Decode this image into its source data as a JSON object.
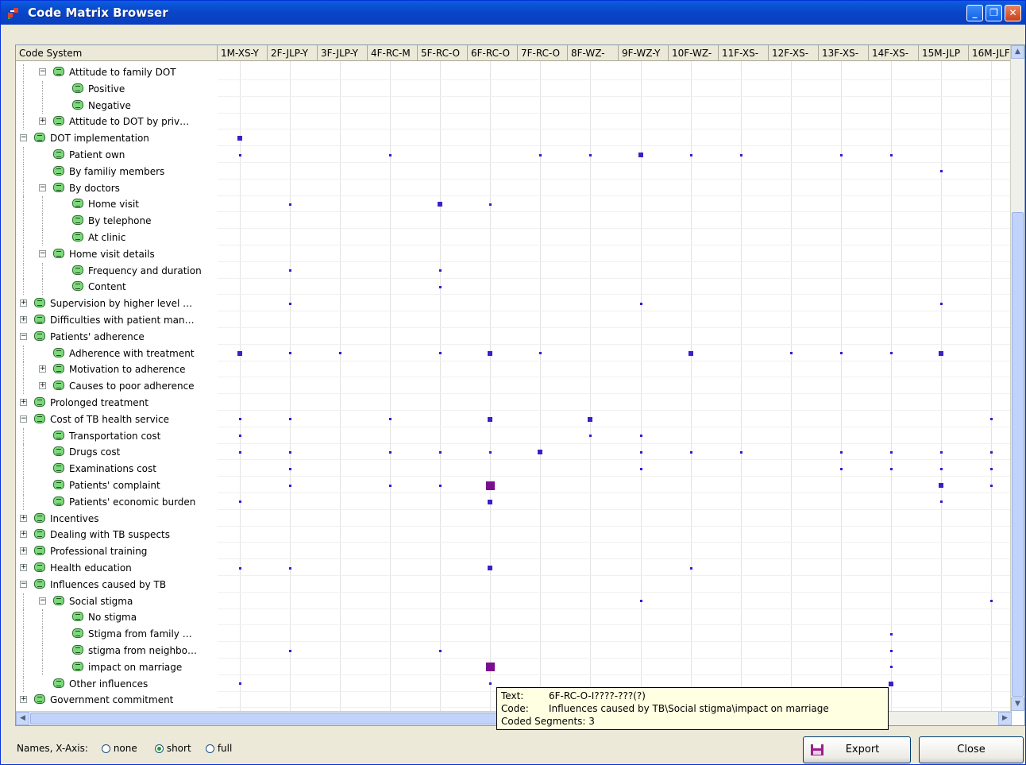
{
  "window": {
    "title": "Code Matrix Browser",
    "minimize": "_",
    "maximize": "❐",
    "close": "✕"
  },
  "header": {
    "code_system_label": "Code System",
    "columns": [
      "1M-XS-Y",
      "2F-JLP-Y",
      "3F-JLP-Y",
      "4F-RC-M",
      "5F-RC-O",
      "6F-RC-O",
      "7F-RC-O",
      "8F-WZ-",
      "9F-WZ-Y",
      "10F-WZ-",
      "11F-XS-",
      "12F-XS-",
      "13F-XS-",
      "14F-XS-",
      "15M-JLP",
      "16M-JLF"
    ]
  },
  "rows": [
    {
      "label": "Attitude to family DOT",
      "level": 1,
      "expander": "-"
    },
    {
      "label": "Positive",
      "level": 2,
      "expander": ""
    },
    {
      "label": "Negative",
      "level": 2,
      "expander": ""
    },
    {
      "label": "Attitude to DOT by priv…",
      "level": 1,
      "expander": "+"
    },
    {
      "label": "DOT implementation",
      "level": 0,
      "expander": "-"
    },
    {
      "label": "Patient own",
      "level": 1,
      "expander": ""
    },
    {
      "label": "By familiy members",
      "level": 1,
      "expander": ""
    },
    {
      "label": "By doctors",
      "level": 1,
      "expander": "-"
    },
    {
      "label": "Home visit",
      "level": 2,
      "expander": ""
    },
    {
      "label": "By telephone",
      "level": 2,
      "expander": ""
    },
    {
      "label": "At clinic",
      "level": 2,
      "expander": ""
    },
    {
      "label": "Home visit details",
      "level": 1,
      "expander": "-"
    },
    {
      "label": "Frequency and duration",
      "level": 2,
      "expander": ""
    },
    {
      "label": "Content",
      "level": 2,
      "expander": ""
    },
    {
      "label": "Supervision by higher level …",
      "level": 0,
      "expander": "+"
    },
    {
      "label": "Difficulties with patient man…",
      "level": 0,
      "expander": "+"
    },
    {
      "label": "Patients' adherence",
      "level": 0,
      "expander": "-"
    },
    {
      "label": "Adherence with treatment",
      "level": 1,
      "expander": ""
    },
    {
      "label": "Motivation to adherence",
      "level": 1,
      "expander": "+"
    },
    {
      "label": "Causes to poor adherence",
      "level": 1,
      "expander": "+"
    },
    {
      "label": "Prolonged treatment",
      "level": 0,
      "expander": "+"
    },
    {
      "label": "Cost of TB health service",
      "level": 0,
      "expander": "-"
    },
    {
      "label": "Transportation cost",
      "level": 1,
      "expander": ""
    },
    {
      "label": "Drugs cost",
      "level": 1,
      "expander": ""
    },
    {
      "label": "Examinations cost",
      "level": 1,
      "expander": ""
    },
    {
      "label": "Patients' complaint",
      "level": 1,
      "expander": ""
    },
    {
      "label": "Patients' economic burden",
      "level": 1,
      "expander": ""
    },
    {
      "label": "Incentives",
      "level": 0,
      "expander": "+"
    },
    {
      "label": "Dealing with TB suspects",
      "level": 0,
      "expander": "+"
    },
    {
      "label": "Professional training",
      "level": 0,
      "expander": "+"
    },
    {
      "label": "Health education",
      "level": 0,
      "expander": "+"
    },
    {
      "label": "Influences caused by TB",
      "level": 0,
      "expander": "-"
    },
    {
      "label": "Social stigma",
      "level": 1,
      "expander": "-"
    },
    {
      "label": "No stigma",
      "level": 2,
      "expander": ""
    },
    {
      "label": "Stigma from family …",
      "level": 2,
      "expander": ""
    },
    {
      "label": "stigma from neighbo…",
      "level": 2,
      "expander": ""
    },
    {
      "label": "impact on marriage",
      "level": 2,
      "expander": ""
    },
    {
      "label": "Other influences",
      "level": 1,
      "expander": ""
    },
    {
      "label": "Government commitment",
      "level": 0,
      "expander": "+"
    }
  ],
  "matrix_cells": [
    [
      4,
      0,
      2
    ],
    [
      5,
      0,
      1
    ],
    [
      5,
      3,
      1
    ],
    [
      5,
      6,
      1
    ],
    [
      5,
      7,
      1
    ],
    [
      5,
      8,
      2
    ],
    [
      5,
      9,
      1
    ],
    [
      5,
      10,
      1
    ],
    [
      5,
      12,
      1
    ],
    [
      5,
      13,
      1
    ],
    [
      6,
      14,
      1
    ],
    [
      8,
      1,
      1
    ],
    [
      8,
      4,
      2
    ],
    [
      8,
      5,
      1
    ],
    [
      12,
      1,
      1
    ],
    [
      12,
      4,
      1
    ],
    [
      13,
      4,
      1
    ],
    [
      14,
      1,
      1
    ],
    [
      14,
      8,
      1
    ],
    [
      14,
      14,
      1
    ],
    [
      17,
      0,
      2
    ],
    [
      17,
      1,
      1
    ],
    [
      17,
      2,
      1
    ],
    [
      17,
      4,
      1
    ],
    [
      17,
      5,
      2
    ],
    [
      17,
      6,
      1
    ],
    [
      17,
      9,
      2
    ],
    [
      17,
      11,
      1
    ],
    [
      17,
      12,
      1
    ],
    [
      17,
      13,
      1
    ],
    [
      17,
      14,
      2
    ],
    [
      21,
      0,
      1
    ],
    [
      21,
      1,
      1
    ],
    [
      21,
      3,
      1
    ],
    [
      21,
      5,
      2
    ],
    [
      21,
      7,
      2
    ],
    [
      21,
      15,
      1
    ],
    [
      22,
      0,
      1
    ],
    [
      22,
      7,
      1
    ],
    [
      22,
      8,
      1
    ],
    [
      23,
      0,
      1
    ],
    [
      23,
      1,
      1
    ],
    [
      23,
      3,
      1
    ],
    [
      23,
      4,
      1
    ],
    [
      23,
      5,
      1
    ],
    [
      23,
      6,
      2
    ],
    [
      23,
      8,
      1
    ],
    [
      23,
      9,
      1
    ],
    [
      23,
      10,
      1
    ],
    [
      23,
      12,
      1
    ],
    [
      23,
      13,
      1
    ],
    [
      23,
      14,
      1
    ],
    [
      23,
      15,
      1
    ],
    [
      24,
      1,
      1
    ],
    [
      24,
      8,
      1
    ],
    [
      24,
      12,
      1
    ],
    [
      24,
      13,
      1
    ],
    [
      24,
      14,
      1
    ],
    [
      24,
      15,
      1
    ],
    [
      25,
      1,
      1
    ],
    [
      25,
      3,
      1
    ],
    [
      25,
      4,
      1
    ],
    [
      25,
      5,
      3
    ],
    [
      25,
      14,
      2
    ],
    [
      25,
      15,
      1
    ],
    [
      26,
      0,
      1
    ],
    [
      26,
      5,
      2
    ],
    [
      26,
      14,
      1
    ],
    [
      30,
      0,
      1
    ],
    [
      30,
      1,
      1
    ],
    [
      30,
      5,
      2
    ],
    [
      30,
      9,
      1
    ],
    [
      32,
      8,
      1
    ],
    [
      32,
      15,
      1
    ],
    [
      34,
      13,
      1
    ],
    [
      35,
      1,
      1
    ],
    [
      35,
      4,
      1
    ],
    [
      35,
      13,
      1
    ],
    [
      36,
      5,
      3
    ],
    [
      36,
      13,
      1
    ],
    [
      37,
      0,
      1
    ],
    [
      37,
      5,
      1
    ],
    [
      37,
      13,
      2
    ]
  ],
  "tooltip": {
    "text_label": "Text:",
    "text_value": "6F-RC-O-I????-???(?)",
    "code_label": "Code:",
    "code_value": "Influences caused by TB\\Social stigma\\impact on marriage",
    "segments_label": "Coded Segments:",
    "segments_value": "3"
  },
  "bottom": {
    "names_label": "Names, X-Axis:",
    "options": [
      {
        "label": "none",
        "selected": false
      },
      {
        "label": "short",
        "selected": true
      },
      {
        "label": "full",
        "selected": false
      }
    ],
    "export_label": "Export",
    "close_label": "Close"
  },
  "colors": {
    "accent": "#2e1fd1",
    "title_bar": "#0a46c8"
  }
}
